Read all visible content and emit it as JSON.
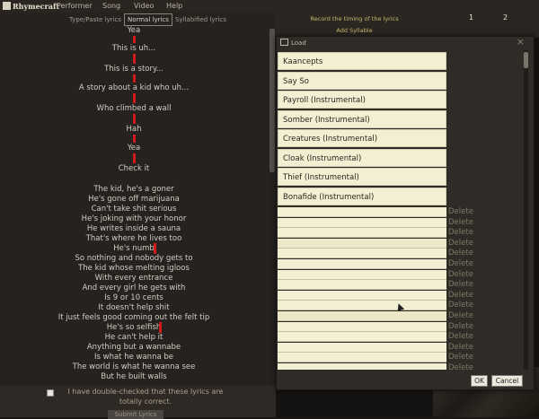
{
  "menubar": {
    "logo": "Rhymecraft",
    "items": [
      "Performer",
      "Song",
      "Video",
      "Help"
    ]
  },
  "lyric_modes": [
    "Type/Paste lyrics",
    "Normal lyrics",
    "Syllabified lyrics"
  ],
  "lyric_modes_active": "Normal lyrics",
  "lyrics": [
    "Yea",
    "This is uh...",
    "This is a story...",
    "A story about a kid who uh...",
    "Who climbed a wall",
    "Hah",
    "Yea",
    "Check it",
    "The kid, he's a goner",
    "He's gone off marijuana",
    "Can't take shit serious",
    "He's joking with your honor",
    "He writes inside a sauna",
    "That's where he lives too",
    "He's numb",
    "So nothing and nobody gets to",
    "The kid whose melting igloos",
    "With every entrance",
    "And every girl he gets with",
    "Is 9 or 10 cents",
    "It doesn't help shit",
    "It just feels good coming out the felt tip",
    "He's so selfish",
    "He can't help it",
    "Anything but a wannabe",
    "Is what he wanna be",
    "The world is what he wanna see",
    "But he built walls"
  ],
  "confirm": {
    "text": "I have double-checked that these lyrics are totally correct.",
    "button": "Submit Lyrics"
  },
  "timing": {
    "record_label": "Record the timing of the lyrics",
    "add_syllable": "Add Syllable",
    "columns": [
      "1",
      "2"
    ]
  },
  "dialog": {
    "title": "Load",
    "close_icon": "×",
    "songs": [
      "Kaancepts",
      "Say So",
      "Payroll (Instrumental)",
      "Somber (Instrumental)",
      "Creatures (Instrumental)",
      "Cloak (Instrumental)",
      "Thief (Instrumental)",
      "Bonafide (Instrumental)"
    ],
    "empty_rows": 16,
    "delete_label": "Delete",
    "ok_label": "OK",
    "cancel_label": "Cancel"
  },
  "colors": {
    "beat_marker": "#d31a1a",
    "accent_text": "#c7b96a"
  }
}
